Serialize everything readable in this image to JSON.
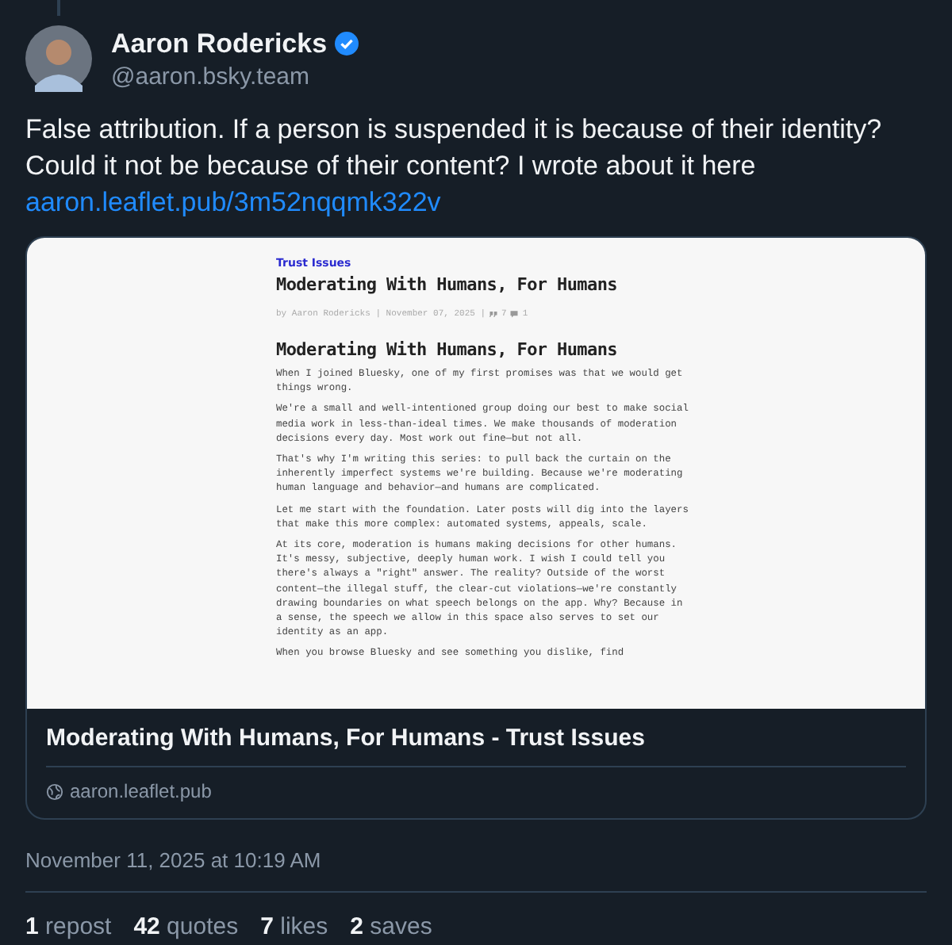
{
  "author": {
    "name": "Aaron Rodericks",
    "verified": true,
    "handle": "@aaron.bsky.team"
  },
  "post": {
    "text": "False attribution. If a person is suspended it is because of their identity? Could it not be because of their content? I wrote about it here",
    "link": "aaron.leaflet.pub/3m52nqqmk322v"
  },
  "link_card": {
    "preview": {
      "publication": "Trust Issues",
      "title": "Moderating With Humans, For Humans",
      "byline": "by Aaron Rodericks | November 07, 2025 |",
      "quote_count": "7",
      "comment_count": "1",
      "heading": "Moderating With Humans, For Humans",
      "paragraphs": [
        "When I joined Bluesky, one of my first promises was that we would get things wrong.",
        "We're a small and well-intentioned group doing our best to make social media work in less-than-ideal times. We make thousands of moderation decisions every day. Most work out fine—but not all.",
        "That's why I'm writing this series: to pull back the curtain on the inherently imperfect systems we're building. Because we're moderating human language and behavior—and humans are complicated.",
        "Let me start with the foundation. Later posts will dig into the layers that make this more complex: automated systems, appeals, scale.",
        "At its core, moderation is humans making decisions for other humans. It's messy, subjective, deeply human work. I wish I could tell you there's always a \"right\" answer. The reality? Outside of the worst content—the illegal stuff, the clear-cut violations—we're constantly drawing boundaries on what speech belongs on the app. Why? Because in a sense, the speech we allow in this space also serves to set our identity as an app.",
        "When you browse Bluesky and see something you dislike, find"
      ]
    },
    "title": "Moderating With Humans, For Humans - Trust Issues",
    "domain": "aaron.leaflet.pub"
  },
  "timestamp": "November 11, 2025 at 10:19 AM",
  "stats": [
    {
      "count": "1",
      "label": "repost"
    },
    {
      "count": "42",
      "label": "quotes"
    },
    {
      "count": "7",
      "label": "likes"
    },
    {
      "count": "2",
      "label": "saves"
    }
  ]
}
